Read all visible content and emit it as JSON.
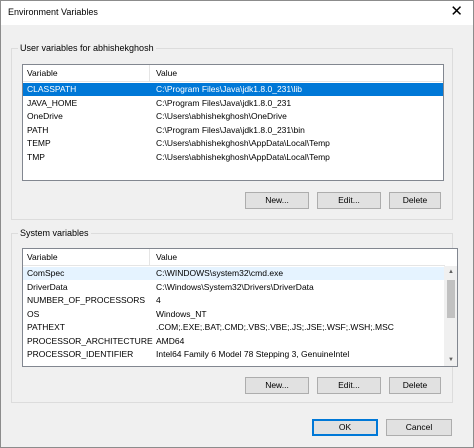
{
  "window": {
    "title": "Environment Variables",
    "close_glyph": "✕"
  },
  "user_vars": {
    "group_label": "User variables for abhishekghosh",
    "columns": {
      "variable": "Variable",
      "value": "Value"
    },
    "rows": [
      {
        "variable": "CLASSPATH",
        "value": "C:\\Program Files\\Java\\jdk1.8.0_231\\lib"
      },
      {
        "variable": "JAVA_HOME",
        "value": "C:\\Program Files\\Java\\jdk1.8.0_231"
      },
      {
        "variable": "OneDrive",
        "value": "C:\\Users\\abhishekghosh\\OneDrive"
      },
      {
        "variable": "PATH",
        "value": "C:\\Program Files\\Java\\jdk1.8.0_231\\bin"
      },
      {
        "variable": "TEMP",
        "value": "C:\\Users\\abhishekghosh\\AppData\\Local\\Temp"
      },
      {
        "variable": "TMP",
        "value": "C:\\Users\\abhishekghosh\\AppData\\Local\\Temp"
      }
    ],
    "selected_row": "CLASSPATH",
    "buttons": {
      "new": "New...",
      "edit": "Edit...",
      "delete": "Delete"
    }
  },
  "system_vars": {
    "group_label": "System variables",
    "columns": {
      "variable": "Variable",
      "value": "Value"
    },
    "rows": [
      {
        "variable": "ComSpec",
        "value": "C:\\WINDOWS\\system32\\cmd.exe"
      },
      {
        "variable": "DriverData",
        "value": "C:\\Windows\\System32\\Drivers\\DriverData"
      },
      {
        "variable": "NUMBER_OF_PROCESSORS",
        "value": "4"
      },
      {
        "variable": "OS",
        "value": "Windows_NT"
      },
      {
        "variable": "PATHEXT",
        "value": ".COM;.EXE;.BAT;.CMD;.VBS;.VBE;.JS;.JSE;.WSF;.WSH;.MSC"
      },
      {
        "variable": "PROCESSOR_ARCHITECTURE",
        "value": "AMD64"
      },
      {
        "variable": "PROCESSOR_IDENTIFIER",
        "value": "Intel64 Family 6 Model 78 Stepping 3, GenuineIntel"
      }
    ],
    "hovered_row": "ComSpec",
    "buttons": {
      "new": "New...",
      "edit": "Edit...",
      "delete": "Delete"
    }
  },
  "dialog_buttons": {
    "ok": "OK",
    "cancel": "Cancel"
  },
  "colors": {
    "selection": "#0078d7",
    "hover": "#e5f3ff",
    "default_border": "#0078d7"
  }
}
